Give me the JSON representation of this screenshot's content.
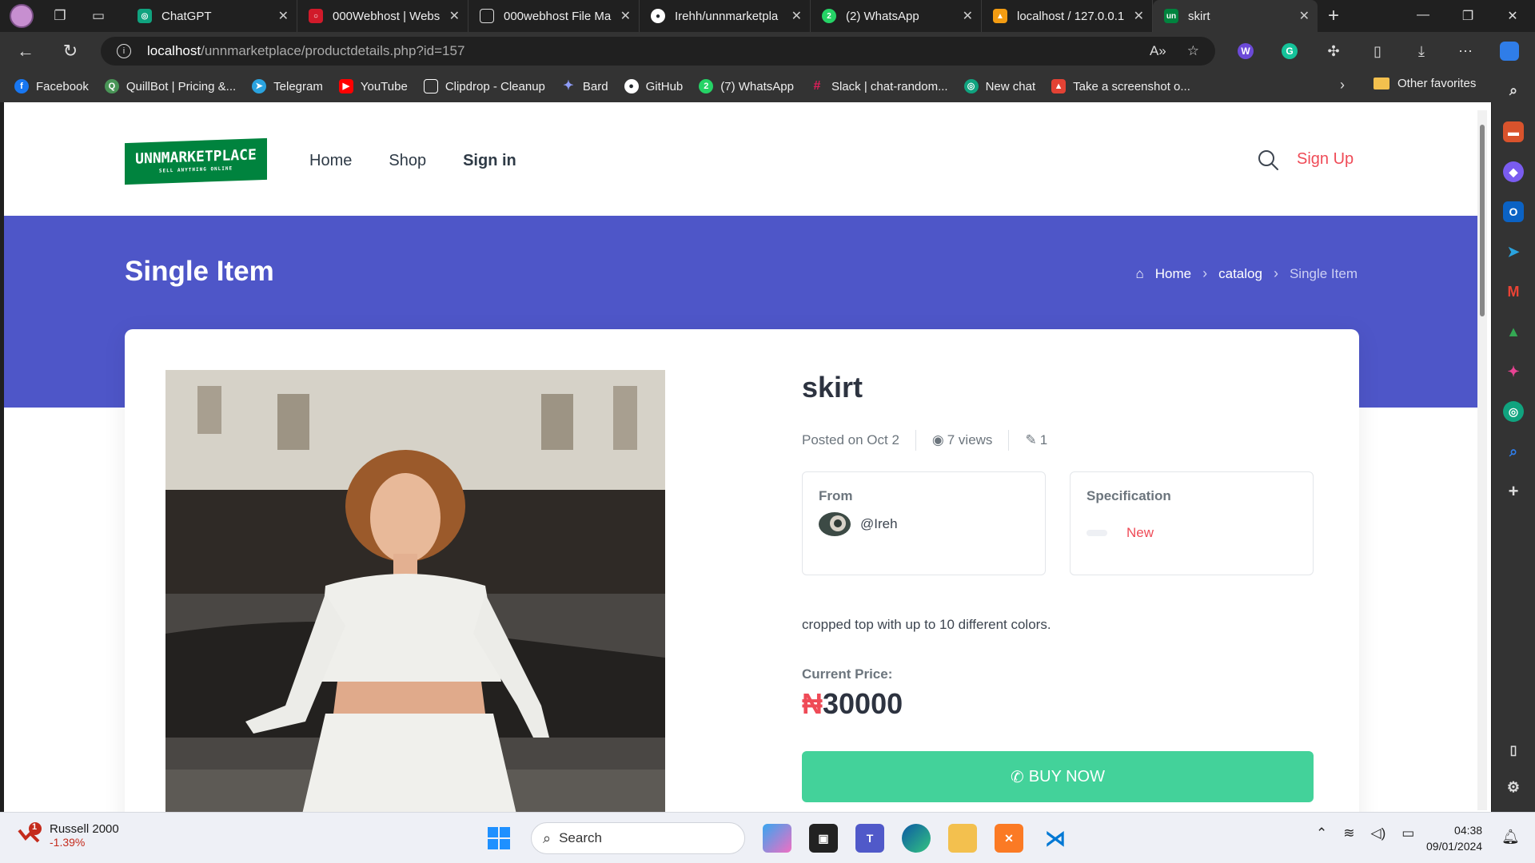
{
  "browser": {
    "tabs": [
      {
        "title": "ChatGPT",
        "favicon": "chatgpt-icon",
        "color": "#10a37f"
      },
      {
        "title": "000Webhost | Webs",
        "favicon": "000webhost-icon",
        "color": "#d11a2a"
      },
      {
        "title": "000webhost File Ma",
        "favicon": "file-icon",
        "color": "#555555"
      },
      {
        "title": "Irehh/unnmarketpla",
        "favicon": "github-icon",
        "color": "#24292e"
      },
      {
        "title": "(2) WhatsApp",
        "favicon": "whatsapp-icon",
        "color": "#25d366"
      },
      {
        "title": "localhost / 127.0.0.1",
        "favicon": "phpmyadmin-icon",
        "color": "#f39c12"
      },
      {
        "title": "skirt",
        "favicon": "site-icon",
        "color": "#00833e"
      }
    ],
    "active_tab": 6,
    "url_host": "localhost",
    "url_path": "/unnmarketplace/productdetails.php?id=157",
    "bookmarks": [
      {
        "label": "Facebook",
        "color": "#1877f2",
        "glyph": "f"
      },
      {
        "label": "QuillBot | Pricing &...",
        "color": "#499557",
        "glyph": "Q"
      },
      {
        "label": "Telegram",
        "color": "#2aa3df",
        "glyph": "➤"
      },
      {
        "label": "YouTube",
        "color": "#ff0000",
        "glyph": "▶"
      },
      {
        "label": "Clipdrop - Cleanup",
        "color": "#111111",
        "glyph": "◌"
      },
      {
        "label": "Bard",
        "color": "#4a6cf7",
        "glyph": "✦"
      },
      {
        "label": "GitHub",
        "color": "#24292e",
        "glyph": "●"
      },
      {
        "label": "(7) WhatsApp",
        "color": "#25d366",
        "glyph": "2"
      },
      {
        "label": "Slack | chat-random...",
        "color": "#e01e5a",
        "glyph": "#"
      },
      {
        "label": "New chat",
        "color": "#10a37f",
        "glyph": "◎"
      },
      {
        "label": "Take a screenshot o...",
        "color": "#e34234",
        "glyph": "▲"
      }
    ],
    "other_favorites": "Other favorites"
  },
  "site": {
    "logo_text": "UNNMARKETPLACE",
    "logo_tagline": "SELL ANYTHING ONLINE",
    "nav": {
      "home": "Home",
      "shop": "Shop",
      "signin": "Sign in",
      "signup": "Sign Up"
    }
  },
  "hero": {
    "title": "Single Item",
    "breadcrumb": {
      "home": "Home",
      "catalog": "catalog",
      "current": "Single Item"
    }
  },
  "product": {
    "name": "skirt",
    "posted": "Posted on Oct 2",
    "views": "7 views",
    "likes": "1",
    "from_label": "From",
    "seller": "@Ireh",
    "spec_label": "Specification",
    "condition": "New",
    "description": "cropped top with up to 10 different colors.",
    "price_label": "Current Price:",
    "currency": "₦",
    "price": "30000",
    "buy_label": "BUY NOW"
  },
  "taskbar": {
    "stock_name": "Russell 2000",
    "stock_change": "-1.39%",
    "stock_badge": "1",
    "search_label": "Search",
    "time": "04:38",
    "date": "09/01/2024"
  }
}
